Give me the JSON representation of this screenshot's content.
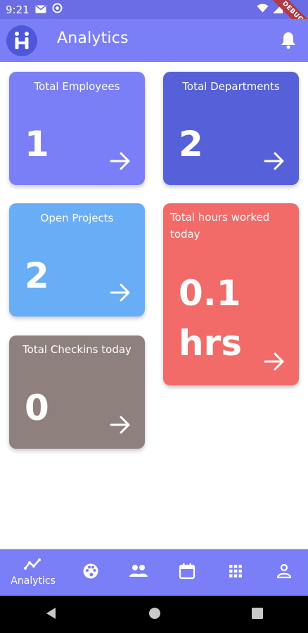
{
  "status": {
    "time": "9:21",
    "debug": "DEBUG"
  },
  "appbar": {
    "title": "Analytics"
  },
  "cards": {
    "employees": {
      "title": "Total Employees",
      "value": "1",
      "color": "#7b7ff7"
    },
    "departments": {
      "title": "Total Departments",
      "value": "2",
      "color": "#5660d8"
    },
    "projects": {
      "title": "Open Projects",
      "value": "2",
      "color": "#67aef7"
    },
    "hours": {
      "title": "Total hours worked today",
      "value_line1": "0.1",
      "value_line2": "hrs",
      "color": "#f36b69"
    },
    "checkins": {
      "title": "Total Checkins today",
      "value": "0",
      "color": "#8e807d"
    }
  },
  "bottom_nav": {
    "items": [
      {
        "icon": "analytics-icon",
        "label": "Analytics"
      },
      {
        "icon": "palette-icon"
      },
      {
        "icon": "people-icon"
      },
      {
        "icon": "calendar-icon"
      },
      {
        "icon": "apps-grid-icon"
      },
      {
        "icon": "person-icon"
      }
    ]
  },
  "colors": {
    "status_bar": "#6a6de6",
    "app_bar": "#7b7ff7",
    "bottom_nav": "#7b7ff7"
  }
}
